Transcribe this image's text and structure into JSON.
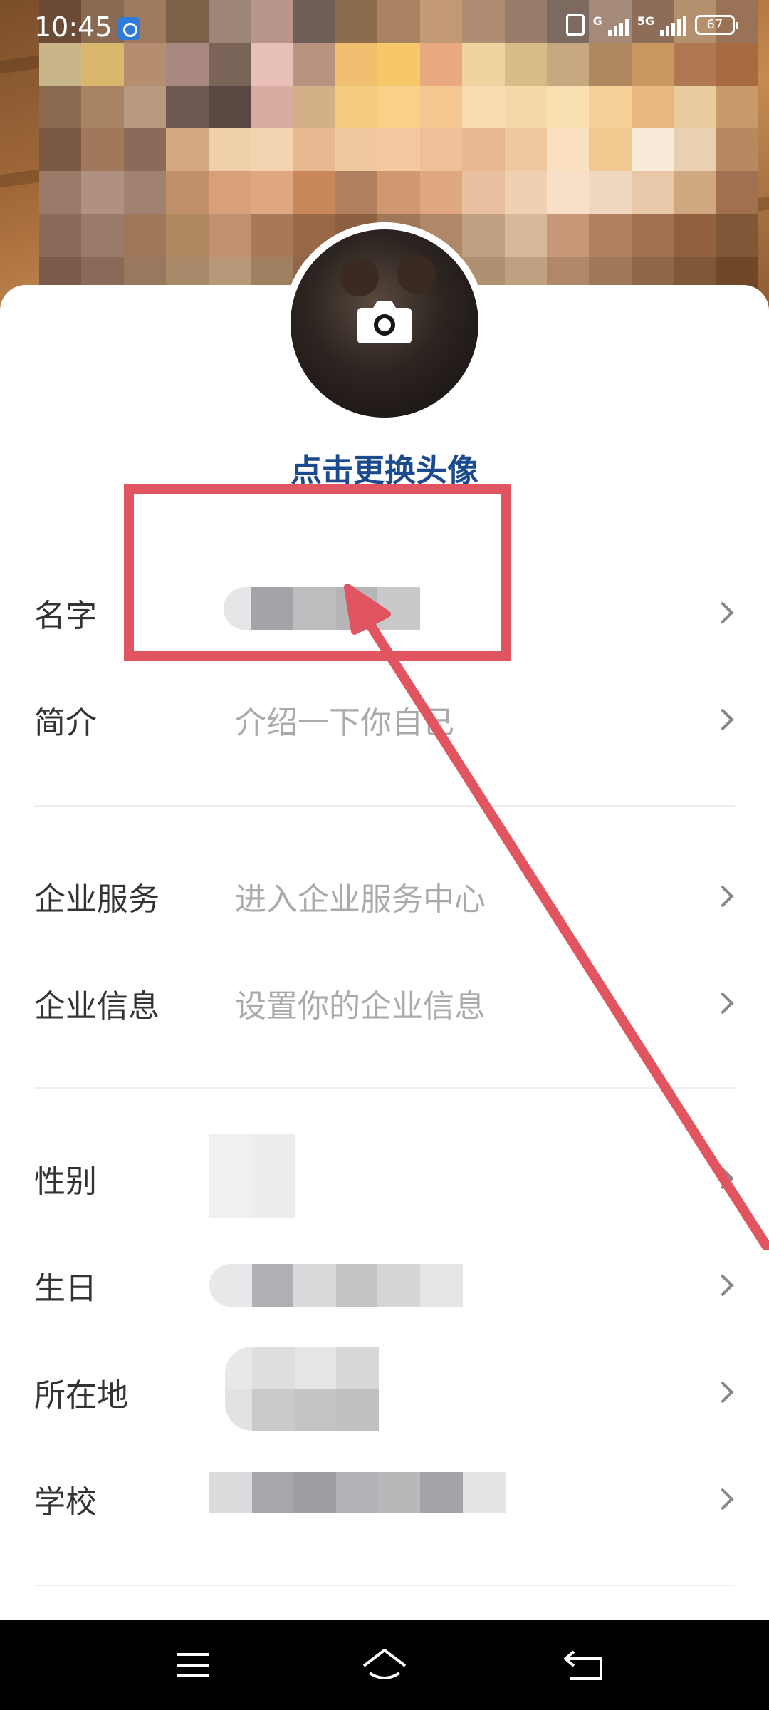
{
  "status_bar": {
    "time": "10:45",
    "signal_1_label": "G",
    "signal_2_label": "5G",
    "battery": "67"
  },
  "profile": {
    "change_avatar": "点击更换头像"
  },
  "rows": {
    "name": {
      "label": "名字",
      "value": ""
    },
    "bio": {
      "label": "简介",
      "value": "介绍一下你自己"
    },
    "enterprise_service": {
      "label": "企业服务",
      "value": "进入企业服务中心"
    },
    "enterprise_info": {
      "label": "企业信息",
      "value": "设置你的企业信息"
    },
    "gender": {
      "label": "性别",
      "value": ""
    },
    "birthday": {
      "label": "生日",
      "value": ""
    },
    "location": {
      "label": "所在地",
      "value": ""
    },
    "school": {
      "label": "学校",
      "value": ""
    }
  },
  "colors": {
    "accent_text": "#1b4a8e",
    "annotation": "#e05560",
    "label_text": "#333333",
    "placeholder_text": "#aaaaaa"
  },
  "icons": {
    "camera": "camera-icon",
    "chevron": "chevron-right-icon",
    "alarm": "alarm-icon",
    "nav_menu": "menu-icon",
    "nav_home": "home-icon",
    "nav_back": "back-icon"
  }
}
